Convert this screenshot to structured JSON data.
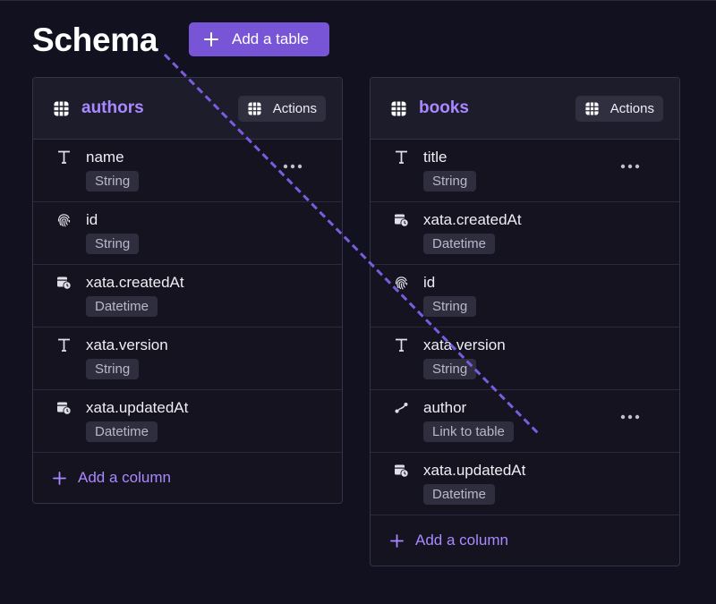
{
  "page": {
    "title": "Schema",
    "add_table_label": "Add a table"
  },
  "tables": [
    {
      "name": "authors",
      "actions_label": "Actions",
      "add_column_label": "Add a column",
      "columns": [
        {
          "name": "name",
          "type": "String",
          "icon": "text-type-icon",
          "menu": true
        },
        {
          "name": "id",
          "type": "String",
          "icon": "fingerprint-icon",
          "menu": false
        },
        {
          "name": "xata.createdAt",
          "type": "Datetime",
          "icon": "calendar-clock-icon",
          "menu": false
        },
        {
          "name": "xata.version",
          "type": "String",
          "icon": "text-type-icon",
          "menu": false
        },
        {
          "name": "xata.updatedAt",
          "type": "Datetime",
          "icon": "calendar-clock-icon",
          "menu": false
        }
      ]
    },
    {
      "name": "books",
      "actions_label": "Actions",
      "add_column_label": "Add a column",
      "columns": [
        {
          "name": "title",
          "type": "String",
          "icon": "text-type-icon",
          "menu": true
        },
        {
          "name": "xata.createdAt",
          "type": "Datetime",
          "icon": "calendar-clock-icon",
          "menu": false
        },
        {
          "name": "id",
          "type": "String",
          "icon": "fingerprint-icon",
          "menu": false
        },
        {
          "name": "xata.version",
          "type": "String",
          "icon": "text-type-icon",
          "menu": false
        },
        {
          "name": "author",
          "type": "Link to table",
          "icon": "link-icon",
          "menu": true
        },
        {
          "name": "xata.updatedAt",
          "type": "Datetime",
          "icon": "calendar-clock-icon",
          "menu": false
        }
      ]
    }
  ],
  "colors": {
    "accent": "#7855d6",
    "accent_text": "#a989ff",
    "background": "#12111f"
  }
}
